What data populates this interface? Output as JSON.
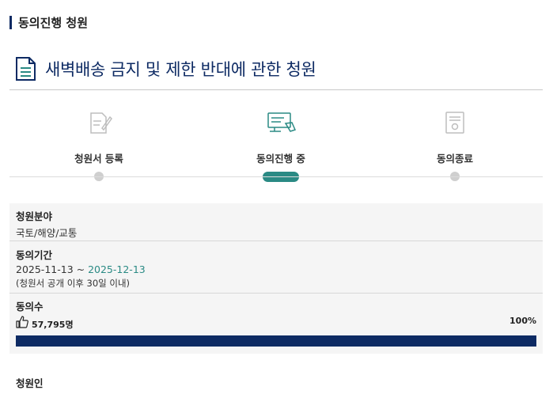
{
  "section": {
    "title": "동의진행 청원"
  },
  "petition": {
    "title": "새벽배송 금지 및 제한 반대에 관한 청원"
  },
  "steps": [
    {
      "label": "청원서 등록",
      "icon": "document-pen-icon",
      "active": false
    },
    {
      "label": "동의진행 중",
      "icon": "monitor-hand-icon",
      "active": true
    },
    {
      "label": "동의종료",
      "icon": "certificate-icon",
      "active": false
    }
  ],
  "info": {
    "field_label": "청원분야",
    "field_value": "국토/해양/교통",
    "period_label": "동의기간",
    "period_start": "2025-11-13",
    "period_sep": " ~ ",
    "period_end": "2025-12-13",
    "period_note": "(청원서 공개 이후 30일 이내)",
    "votes_label": "동의수",
    "votes_count": "57,795명",
    "votes_percent_text": "100%",
    "votes_progress": 1.0
  },
  "petitioner_label": "청원인",
  "colors": {
    "navy": "#0d2a63",
    "teal": "#2a8a84"
  }
}
